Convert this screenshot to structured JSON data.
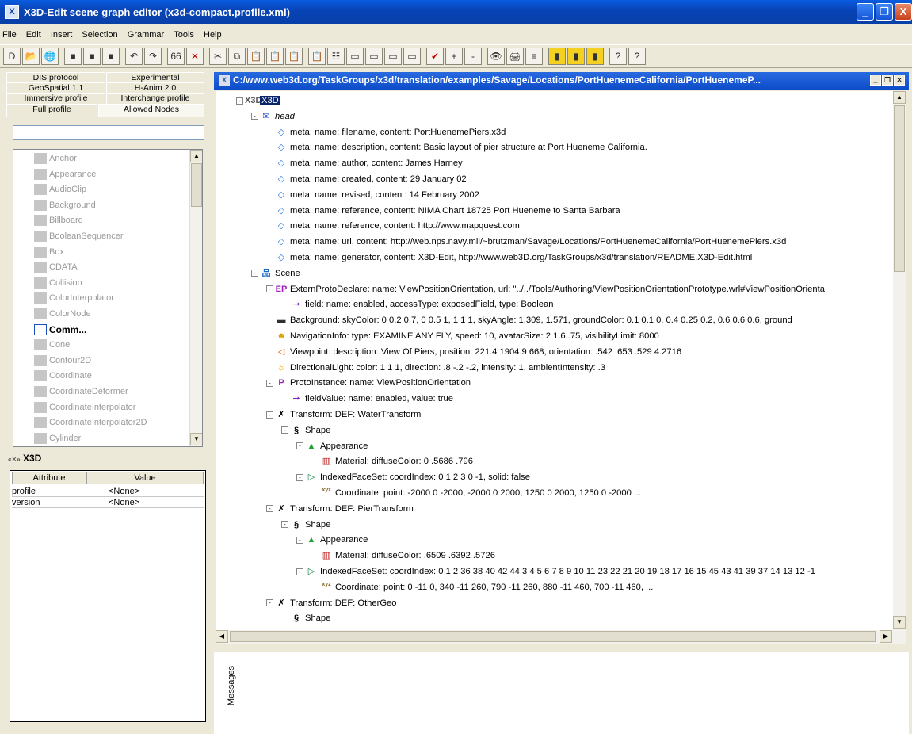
{
  "window": {
    "title": "X3D-Edit scene graph editor (x3d-compact.profile.xml)",
    "app_icon": "x3d-edit-icon",
    "controls": [
      "_",
      "❐",
      "X"
    ]
  },
  "menu": [
    "File",
    "Edit",
    "Insert",
    "Selection",
    "Grammar",
    "Tools",
    "Help"
  ],
  "toolbar_icons": [
    "new-file-icon",
    "open-folder-icon",
    "globe-icon",
    "save-icon",
    "save-all-icon",
    "save-as-icon",
    "undo-icon",
    "redo-icon",
    "find-icon",
    "delete-icon",
    "cut-icon",
    "copy-icon",
    "paste-icon",
    "paste-before-icon",
    "paste-after-icon",
    "paste-child-icon",
    "tree-icon",
    "collapse-icon",
    "expand-icon",
    "expand-all-icon",
    "expand-level-icon",
    "validate-icon",
    "plus-icon",
    "minus-icon",
    "view-icon",
    "print-icon",
    "format-icon",
    "bookmark-1-icon",
    "bookmark-2-icon",
    "bookmark-3-icon",
    "help-icon",
    "context-help-icon"
  ],
  "toolbar_glyphs": [
    "D",
    "📂",
    "🌐",
    "■",
    "■",
    "■",
    "↶",
    "↷",
    "66",
    "✕",
    "✂",
    "⧉",
    "📋",
    "📋",
    "📋",
    "📋",
    "☷",
    "▭",
    "▭",
    "▭",
    "▭",
    "✔",
    "+",
    "-",
    "👁",
    "🖨",
    "≡",
    "▮",
    "▮",
    "▮",
    "?",
    "?"
  ],
  "palette": {
    "tabs": [
      {
        "label": "DIS protocol"
      },
      {
        "label": "Experimental"
      },
      {
        "label": "GeoSpatial 1.1"
      },
      {
        "label": "H-Anim 2.0"
      },
      {
        "label": "Immersive profile"
      },
      {
        "label": "Interchange profile"
      },
      {
        "label": "Full profile"
      },
      {
        "label": "Allowed Nodes"
      }
    ],
    "nodes": [
      "Anchor",
      "Appearance",
      "AudioClip",
      "Background",
      "Billboard",
      "BooleanSequencer",
      "Box",
      "CDATA",
      "Collision",
      "ColorInterpolator",
      "ColorNode",
      "Comm...",
      "Cone",
      "Contour2D",
      "Coordinate",
      "CoordinateDeformer",
      "CoordinateInterpolator",
      "CoordinateInterpolator2D",
      "Cylinder"
    ]
  },
  "attributes": {
    "selected_node": "X3D",
    "headers": [
      "Attribute",
      "Value"
    ],
    "rows": [
      {
        "attr": "profile",
        "value": "<None>"
      },
      {
        "attr": "version",
        "value": "<None>"
      }
    ]
  },
  "document": {
    "path": "C:/www.web3d.org/TaskGroups/x3d/translation/examples/Savage/Locations/PortHuenemeCalifornia/PortHuenemeP...",
    "tree": [
      {
        "d": 0,
        "icon": "x3d-node-icon",
        "g": "X3D",
        "t": "X3D"
      },
      {
        "d": 1,
        "icon": "head-node-icon",
        "g": "✉",
        "t": "head"
      },
      {
        "d": 2,
        "icon": "meta-node-icon",
        "g": "◇",
        "t": "meta:  name: filename, content: PortHuenemePiers.x3d"
      },
      {
        "d": 2,
        "icon": "meta-node-icon",
        "g": "◇",
        "t": "meta:  name: description, content: Basic layout of pier structure at  Port Hueneme California."
      },
      {
        "d": 2,
        "icon": "meta-node-icon",
        "g": "◇",
        "t": "meta:  name: author, content: James Harney"
      },
      {
        "d": 2,
        "icon": "meta-node-icon",
        "g": "◇",
        "t": "meta:  name: created, content: 29 January 02"
      },
      {
        "d": 2,
        "icon": "meta-node-icon",
        "g": "◇",
        "t": "meta:  name: revised, content: 14 February 2002"
      },
      {
        "d": 2,
        "icon": "meta-node-icon",
        "g": "◇",
        "t": "meta:  name: reference, content: NIMA Chart 18725 Port Hueneme to Santa Barbara"
      },
      {
        "d": 2,
        "icon": "meta-node-icon",
        "g": "◇",
        "t": "meta:  name: reference, content: http://www.mapquest.com"
      },
      {
        "d": 2,
        "icon": "meta-node-icon",
        "g": "◇",
        "t": "meta:  name: url, content: http://web.nps.navy.mil/~brutzman/Savage/Locations/PortHuenemeCalifornia/PortHuenemePiers.x3d"
      },
      {
        "d": 2,
        "icon": "meta-node-icon",
        "g": "◇",
        "t": "meta:  name: generator, content: X3D-Edit, http://www.web3D.org/TaskGroups/x3d/translation/README.X3D-Edit.html"
      },
      {
        "d": 1,
        "icon": "scene-node-icon",
        "g": "品",
        "t": "Scene"
      },
      {
        "d": 2,
        "icon": "externprotodeclare-icon",
        "g": "EP",
        "t": "ExternProtoDeclare:  name: ViewPositionOrientation, url: \"../../Tools/Authoring/ViewPositionOrientationPrototype.wrl#ViewPositionOrienta"
      },
      {
        "d": 3,
        "icon": "field-icon",
        "g": "➞",
        "t": "field:  name: enabled, accessType: exposedField, type: Boolean"
      },
      {
        "d": 2,
        "icon": "background-node-icon",
        "g": "▬",
        "t": "Background:  skyColor: 0 0.2 0.7,  0 0.5 1,  1 1 1, skyAngle: 1.309, 1.571, groundColor: 0.1 0.1 0,  0.4 0.25 0.2,  0.6 0.6 0.6, ground"
      },
      {
        "d": 2,
        "icon": "navigationinfo-icon",
        "g": "☻",
        "t": "NavigationInfo:  type: EXAMINE ANY FLY, speed: 10, avatarSize: 2 1.6 .75, visibilityLimit: 8000"
      },
      {
        "d": 2,
        "icon": "viewpoint-icon",
        "g": "◁",
        "t": "Viewpoint:  description: View Of Piers, position: 221.4 1904.9 668, orientation: .542 .653 .529 4.2716"
      },
      {
        "d": 2,
        "icon": "directionallight-icon",
        "g": "☼",
        "t": "DirectionalLight:  color: 1 1 1, direction: .8 -.2 -.2, intensity: 1, ambientIntensity: .3"
      },
      {
        "d": 2,
        "icon": "protoinstance-icon",
        "g": "P",
        "t": "ProtoInstance:  name: ViewPositionOrientation"
      },
      {
        "d": 3,
        "icon": "fieldvalue-icon",
        "g": "➞",
        "t": "fieldValue:  name: enabled, value: true"
      },
      {
        "d": 2,
        "icon": "transform-icon",
        "g": "✗",
        "t": "Transform:  DEF: WaterTransform"
      },
      {
        "d": 3,
        "icon": "shape-icon",
        "g": "§",
        "t": "Shape"
      },
      {
        "d": 4,
        "icon": "appearance-icon",
        "g": "▲",
        "t": "Appearance"
      },
      {
        "d": 5,
        "icon": "material-icon",
        "g": "▥",
        "t": "Material:  diffuseColor: 0 .5686 .796"
      },
      {
        "d": 4,
        "icon": "indexedfaceset-icon",
        "g": "▷",
        "t": "IndexedFaceSet:  coordIndex: 0 1 2 3 0 -1, solid: false"
      },
      {
        "d": 5,
        "icon": "coordinate-icon",
        "g": "xyz",
        "t": "Coordinate:  point: -2000 0 -2000, -2000 0 2000, 1250 0 2000, 1250 0 -2000 ..."
      },
      {
        "d": 2,
        "icon": "transform-icon",
        "g": "✗",
        "t": "Transform:  DEF: PierTransform"
      },
      {
        "d": 3,
        "icon": "shape-icon",
        "g": "§",
        "t": "Shape"
      },
      {
        "d": 4,
        "icon": "appearance-icon",
        "g": "▲",
        "t": "Appearance"
      },
      {
        "d": 5,
        "icon": "material-icon",
        "g": "▥",
        "t": "Material:  diffuseColor: .6509 .6392 .5726"
      },
      {
        "d": 4,
        "icon": "indexedfaceset-icon",
        "g": "▷",
        "t": "IndexedFaceSet:  coordIndex: 0 1 2 36 38 40 42 44 3 4 5 6 7 8 9 10 11 23 22 21 20 19 18 17 16 15 45 43 41 39 37 14 13 12 -1"
      },
      {
        "d": 5,
        "icon": "coordinate-icon",
        "g": "xyz",
        "t": "Coordinate:  point: 0 -11 0, 340 -11 260, 790 -11 260, 880 -11 460, 700 -11 460, ..."
      },
      {
        "d": 2,
        "icon": "transform-icon",
        "g": "✗",
        "t": "Transform:  DEF: OtherGeo"
      },
      {
        "d": 3,
        "icon": "shape-icon",
        "g": "§",
        "t": "Shape"
      }
    ]
  },
  "messages": {
    "label": "Messages"
  }
}
